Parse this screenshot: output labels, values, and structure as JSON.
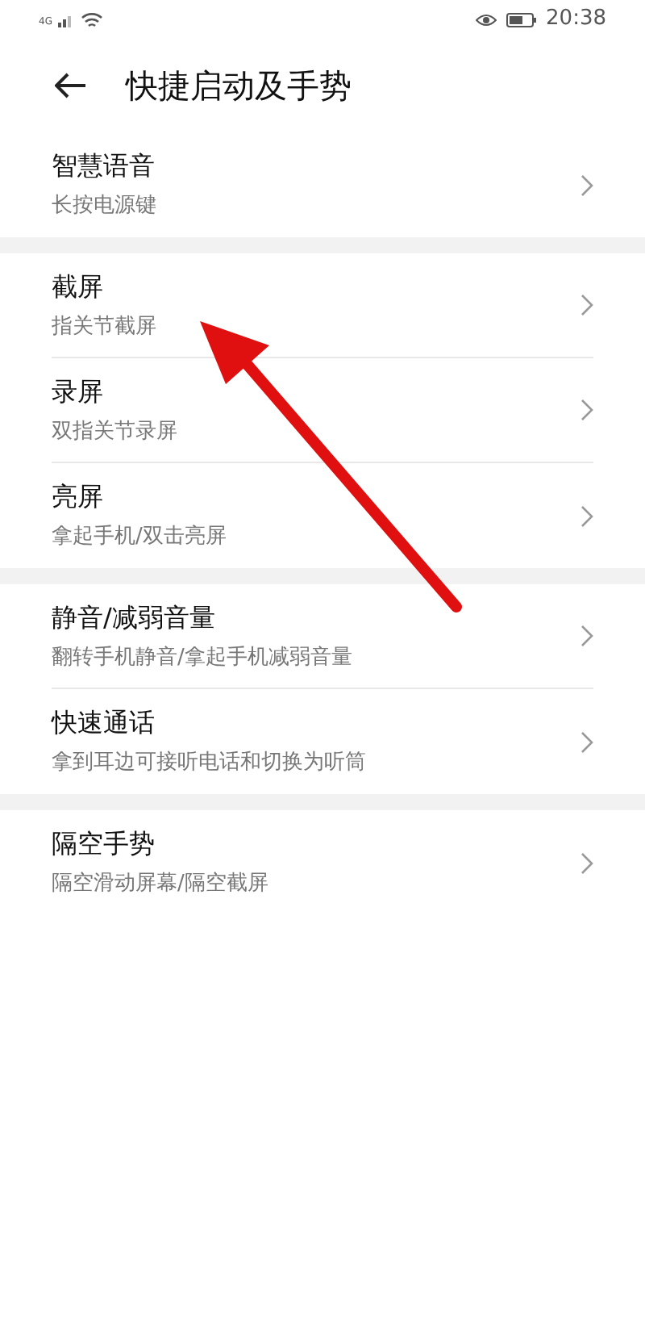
{
  "status_bar": {
    "network": "4G",
    "time": "20:38"
  },
  "header": {
    "title": "快捷启动及手势"
  },
  "groups": [
    {
      "items": [
        {
          "title": "智慧语音",
          "subtitle": "长按电源键"
        }
      ]
    },
    {
      "items": [
        {
          "title": "截屏",
          "subtitle": "指关节截屏"
        },
        {
          "title": "录屏",
          "subtitle": "双指关节录屏"
        },
        {
          "title": "亮屏",
          "subtitle": "拿起手机/双击亮屏"
        }
      ]
    },
    {
      "items": [
        {
          "title": "静音/减弱音量",
          "subtitle": "翻转手机静音/拿起手机减弱音量"
        },
        {
          "title": "快速通话",
          "subtitle": "拿到耳边可接听电话和切换为听筒"
        }
      ]
    },
    {
      "items": [
        {
          "title": "隔空手势",
          "subtitle": "隔空滑动屏幕/隔空截屏"
        }
      ]
    }
  ]
}
